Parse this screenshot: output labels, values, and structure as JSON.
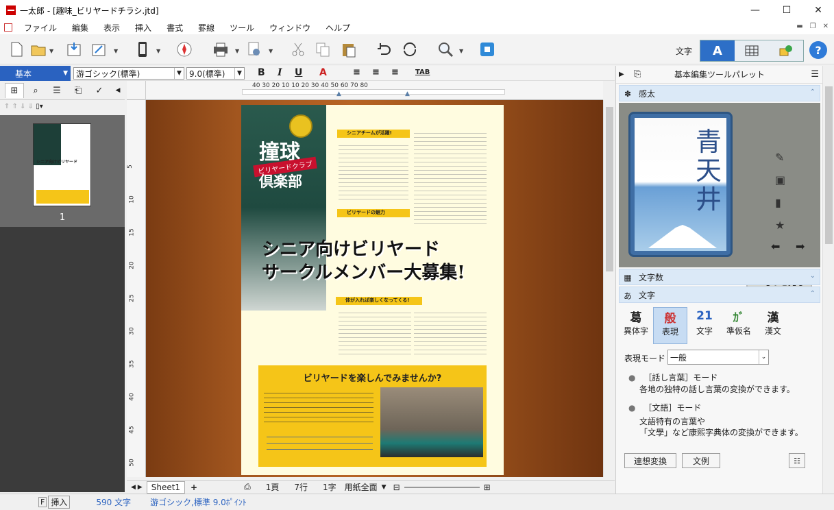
{
  "window": {
    "title": "一太郎 - [趣味_ビリヤードチラシ.jtd]",
    "min": "—",
    "max": "☐",
    "close": "✕"
  },
  "menu": [
    "ファイル",
    "編集",
    "表示",
    "挿入",
    "書式",
    "罫線",
    "ツール",
    "ウィンドウ",
    "ヘルプ"
  ],
  "toolbar": {
    "moji_label": "文字",
    "help": "?"
  },
  "format": {
    "style": "基本",
    "font": "游ゴシック(標準)",
    "size": "9.0(標準)",
    "bold": "B",
    "italic": "I",
    "underline": "U",
    "tab": "TAB"
  },
  "ruler": {
    "h_numbers": "40    30    20    10          10    20    30    40    50    60    70    80",
    "v_numbers": [
      "5",
      "10",
      "15",
      "20",
      "25",
      "30",
      "35",
      "40",
      "45",
      "50"
    ]
  },
  "left_panel": {
    "page_number": "1"
  },
  "flyer": {
    "club_title_1": "撞球",
    "club_sub": "ビリヤードクラブ",
    "club_title_2": "倶楽部",
    "headline_1": "シニア向けビリヤード",
    "headline_2": "サークルメンバー大募集!",
    "sec1_title": "シニアチームが活躍!",
    "sec2_title": "ビリヤードの魅力",
    "sec3_title": "体が入れば楽しくなってくる!",
    "box_title": "ビリヤードを楽しんでみませんか?"
  },
  "bottom_bar": {
    "sheet": "Sheet1",
    "page": "1頁",
    "line": "7行",
    "char": "1字",
    "paper": "用紙全面"
  },
  "status": {
    "f_key": "F",
    "insert": "挿入",
    "count": "590 文字",
    "font_info": "游ゴシック,標準  9.0ﾎﾟｲﾝﾄ"
  },
  "right_panel": {
    "title": "基本編集ツールパレット",
    "kanta_label": "感太",
    "card_text": "青天井",
    "more": "もっと見る",
    "wordcount_label": "文字数",
    "moji_label": "文字",
    "tools": [
      {
        "glyph": "葛",
        "label": "異体字"
      },
      {
        "glyph": "般",
        "label": "表現"
      },
      {
        "glyph": "21",
        "label": "文字"
      },
      {
        "glyph": "ｶﾞ",
        "label": "準仮名"
      },
      {
        "glyph": "漢",
        "label": "漢文"
      }
    ],
    "mode_label": "表現モード",
    "mode_value": "一般",
    "opt1_title": "［話し言葉］モード",
    "opt1_desc": "各地の独特の話し言葉の変換ができます。",
    "opt2_title": "［文語］モード",
    "opt2_desc_1": "文語特有の言葉や",
    "opt2_desc_2": "「文學」など康熙字典体の変換ができます。",
    "btn_assoc": "連想変換",
    "btn_example": "文例"
  },
  "colors": {
    "accent": "#2d6fc7",
    "flyer_yellow": "#f5c518",
    "flyer_bg": "#fffce0"
  }
}
